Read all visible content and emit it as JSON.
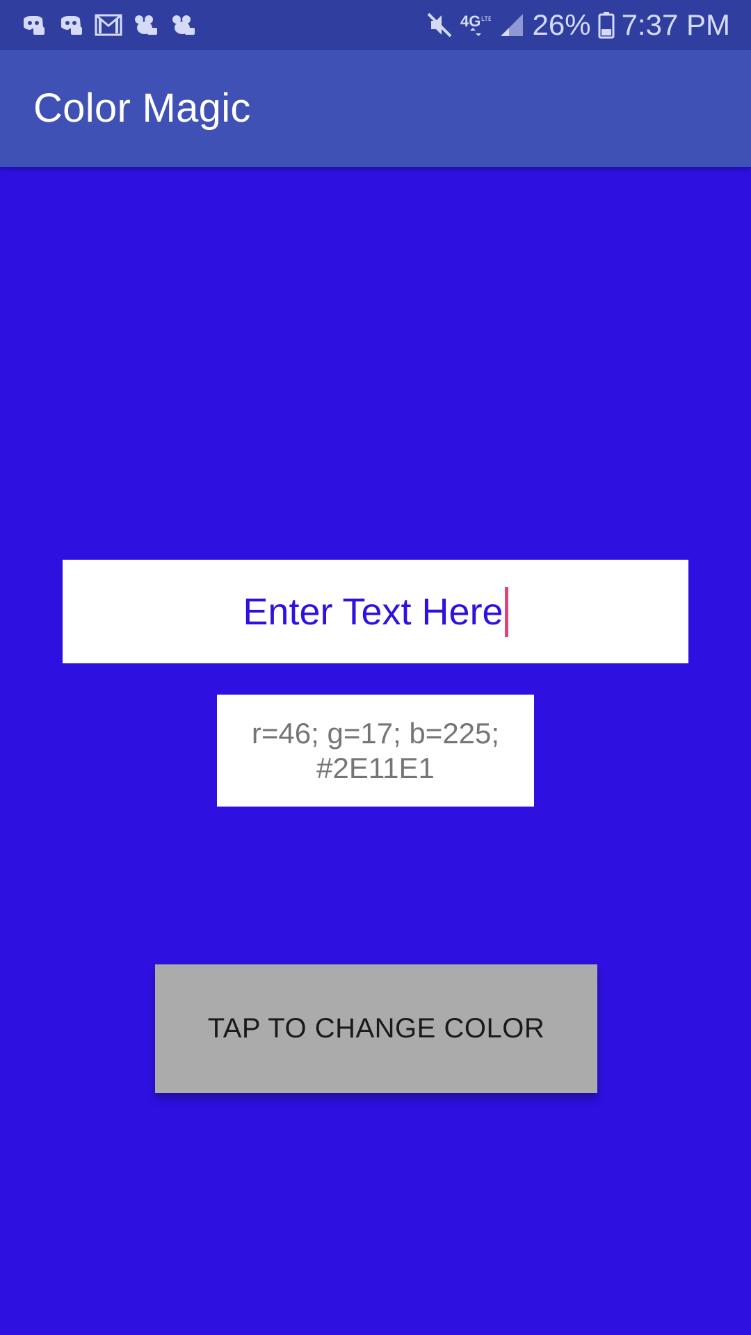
{
  "status_bar": {
    "notifications": [
      {
        "icon": "discord-icon"
      },
      {
        "icon": "discord-icon"
      },
      {
        "icon": "gmail-icon"
      },
      {
        "icon": "mouse-app-icon"
      },
      {
        "icon": "mouse-app-icon"
      }
    ],
    "mute_icon": "mute-icon",
    "network": "4G",
    "signal_icon": "signal-icon",
    "battery_percent": "26%",
    "battery_icon": "battery-icon",
    "time": "7:37 PM"
  },
  "app_bar": {
    "title": "Color Magic"
  },
  "main": {
    "input": {
      "value": "Enter Text Here"
    },
    "readout": {
      "rgb": "r=46; g=17; b=225;",
      "hex": "#2E11E1"
    },
    "button": {
      "label": "TAP TO CHANGE COLOR"
    }
  },
  "colors": {
    "background": "#2E11E1",
    "status_bar": "#303F9F",
    "app_bar": "#3F51B5",
    "button": "#ABABAB",
    "caret": "#E0447A"
  }
}
